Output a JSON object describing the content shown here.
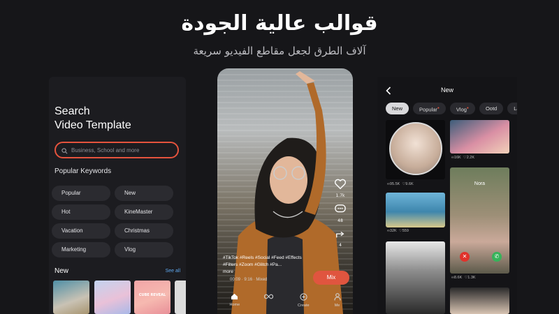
{
  "header": {
    "title": "قوالب عالية الجودة",
    "subtitle": "آلاف الطرق لجعل مقاطع الفيديو سريعة"
  },
  "left_screen": {
    "title_line1": "Search",
    "title_line2": "Video Template",
    "search_placeholder": "Business, School and more",
    "popular_keywords_label": "Popular Keywords",
    "keywords": [
      "Popular",
      "New",
      "Hot",
      "KineMaster",
      "Vacation",
      "Christmas",
      "Marketing",
      "Vlog"
    ],
    "new_label": "New",
    "see_all": "See all",
    "thumb_label": "CUBE REVEAL"
  },
  "center_screen": {
    "like_count": "1.7k",
    "comment_count": "48",
    "share_count": "4",
    "caption": "#TikTok #Reels #Social #Feed #Effects #Filters #Zoom #Glitch #Pa...",
    "more": "more",
    "meta": "00:09 · 9:16 · Mixed",
    "mix_button": "Mix",
    "nav": [
      "Home",
      "",
      "Create",
      "Me"
    ]
  },
  "right_screen": {
    "title": "New",
    "tabs": [
      "New",
      "Popular",
      "Vlog",
      "Ootd",
      "Lab"
    ],
    "cards": [
      {
        "views": "95.5K",
        "likes": "9.6K"
      },
      {
        "views": "16K",
        "likes": "2.2K"
      },
      {
        "views": "32K",
        "likes": "559"
      },
      {
        "views": "8.6K",
        "likes": "1.3K"
      }
    ],
    "card_label": "Nora"
  },
  "colors": {
    "background": "#161619",
    "accent": "#e0553f",
    "link": "#5fa9f0"
  }
}
